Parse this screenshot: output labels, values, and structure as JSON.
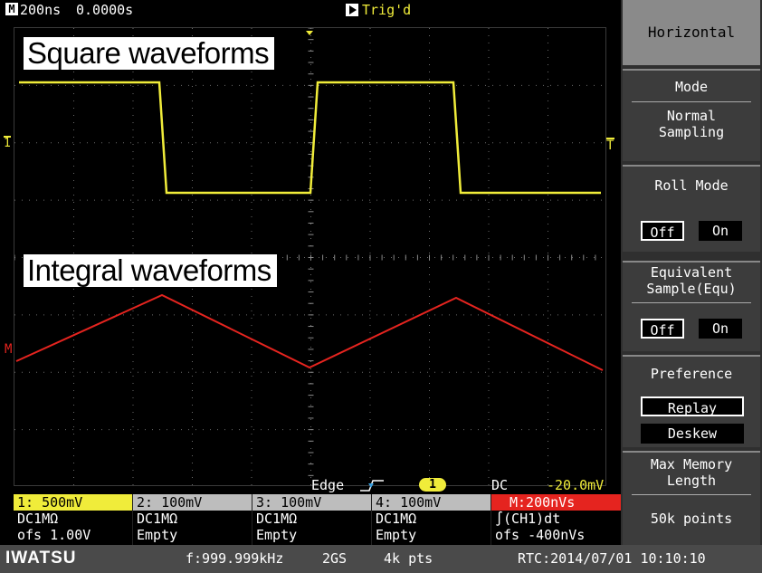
{
  "status": {
    "timebase_icon": "M",
    "timebase": "200ns",
    "position": "0.0000s",
    "trigger_state": "Trig'd"
  },
  "labels": {
    "square": "Square waveforms",
    "integral": "Integral waveforms"
  },
  "markers": {
    "ch1": "1",
    "trigger_level": "T",
    "math": "M"
  },
  "trigger": {
    "type": "Edge",
    "source": "1",
    "coupling": "DC",
    "level": "-20.0mV"
  },
  "channels": [
    {
      "head": "1: 500mV",
      "line1": "DC1MΩ",
      "line2": "ofs    1.00V",
      "color": "#f0ec3a"
    },
    {
      "head": "2: 100mV",
      "line1": "DC1MΩ",
      "line2": "Empty",
      "color": "#bdbdbd"
    },
    {
      "head": "3: 100mV",
      "line1": "DC1MΩ",
      "line2": "Empty",
      "color": "#bdbdbd"
    },
    {
      "head": "4: 100mV",
      "line1": "DC1MΩ",
      "line2": "Empty",
      "color": "#bdbdbd"
    },
    {
      "head": "M:200nVs",
      "line1": "∫(CH1)dt",
      "line2": "ofs   -400nVs",
      "color": "#e5241f"
    }
  ],
  "statusbar": {
    "brand": "IWATSU",
    "frequency": "f:999.999kHz",
    "sample_rate": "2GS",
    "memory": "4k pts",
    "rtc": "RTC:2014/07/01 10:10:10"
  },
  "menu": {
    "title": "Horizontal",
    "mode_label": "Mode",
    "mode_value_1": "Normal",
    "mode_value_2": "Sampling",
    "roll_label": "Roll Mode",
    "roll_off": "Off",
    "roll_on": "On",
    "equ_label_1": "Equivalent",
    "equ_label_2": "Sample(Equ)",
    "equ_off": "Off",
    "equ_on": "On",
    "pref_label": "Preference",
    "pref_replay": "Replay",
    "pref_deskew": "Deskew",
    "maxmem_label_1": "Max Memory",
    "maxmem_label_2": "Length",
    "maxmem_value": "50k points"
  },
  "colors": {
    "ch1": "#f0ec3a",
    "math": "#e5241f",
    "grid": "#6a6a6a"
  }
}
